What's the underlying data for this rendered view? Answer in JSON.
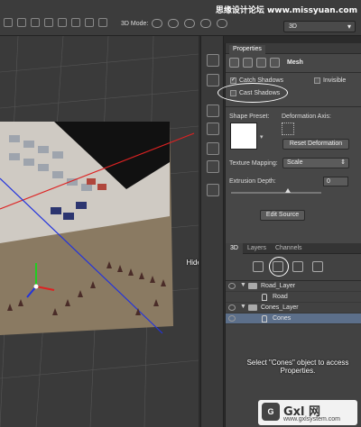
{
  "toolbar": {
    "mode_label": "3D Mode:",
    "view_dropdown": "3D",
    "site": "思缘设计论坛 www.missyuan.com"
  },
  "properties": {
    "tab": "Properties",
    "header": "Mesh",
    "catch_shadows": "Catch Shadows",
    "catch_shadows_checked": true,
    "invisible": "Invisible",
    "invisible_checked": false,
    "cast_shadows": "Cast Shadows",
    "cast_shadows_checked": false,
    "shape_preset_label": "Shape Preset:",
    "deformation_axis_label": "Deformation Axis:",
    "reset_deformation": "Reset Deformation",
    "texture_mapping_label": "Texture Mapping:",
    "texture_mapping_value": "Scale",
    "extrusion_depth_label": "Extrusion Depth:",
    "extrusion_depth_value": "0",
    "edit_source": "Edit Source"
  },
  "panel3d": {
    "tabs": [
      "3D",
      "Layers",
      "Channels"
    ],
    "rows": [
      {
        "label": "Road_Layer",
        "type": "group"
      },
      {
        "label": "Road",
        "type": "mesh"
      },
      {
        "label": "Cones_Layer",
        "type": "group"
      },
      {
        "label": "Cones",
        "type": "mesh",
        "selected": true
      }
    ]
  },
  "annotations": {
    "hide_road": "Hide \"Road\" object",
    "select_cones": "Select \"Cones\" object to access Properties."
  },
  "watermark": {
    "logo": "G",
    "brand": "Gxl 网",
    "url": "www.gxlsystem.com"
  }
}
